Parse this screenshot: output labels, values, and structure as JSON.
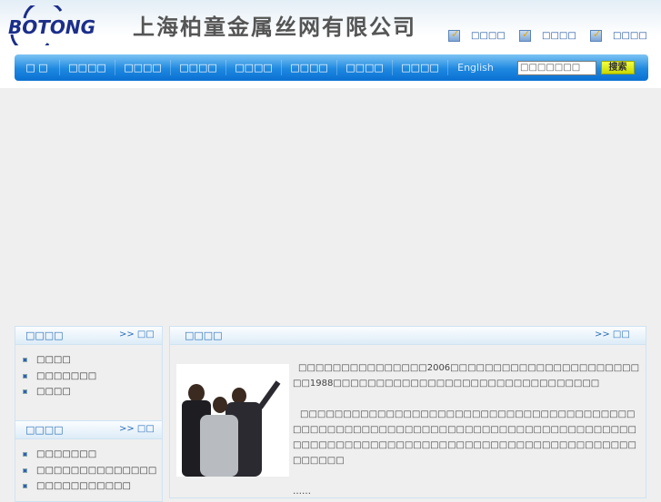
{
  "header": {
    "logo_text": "BOTONG",
    "company_name": "上海柏童金属丝网有限公司",
    "links": [
      "□□□□",
      "□□□□",
      "□□□□"
    ]
  },
  "nav": {
    "items": [
      "□ □",
      "□□□□",
      "□□□□",
      "□□□□",
      "□□□□",
      "□□□□",
      "□□□□",
      "□□□□"
    ],
    "english": "English",
    "search_value": "□□□□□□□",
    "search_button": "搜索"
  },
  "left_panel_1": {
    "title": "□□□□",
    "more": ">> □□",
    "items": [
      "□□□□",
      "□□□□□□□",
      "□□□□"
    ]
  },
  "left_panel_2": {
    "title": "□□□□",
    "more": ">> □□",
    "items": [
      "□□□□□□□",
      "□□□□□□□□□□□□□□",
      "□□□□□□□□□□□"
    ]
  },
  "intro_panel": {
    "title": "□□□□",
    "more": ">> □□",
    "paragraph1": "□□□□□□□□□□□□□□□2006□□□□□□□□□□□□□□□□□□□□□□□□1988□□□□□□□□□□□□□□□□□□□□□□□□□□□□□□□",
    "paragraph2": "□□□□□□□□□□□□□□□□□□□□□□□□□□□□□□□□□□□□□□□□□□□□□□□□□□□□□□□□□□□□□□□□□□□□□□□□□□□□□□□□□□□□□□□□□□□□□□□□□□□□□□□□□□□□□□□□□□□□□□□□□□□□□",
    "ellipsis": "……"
  }
}
